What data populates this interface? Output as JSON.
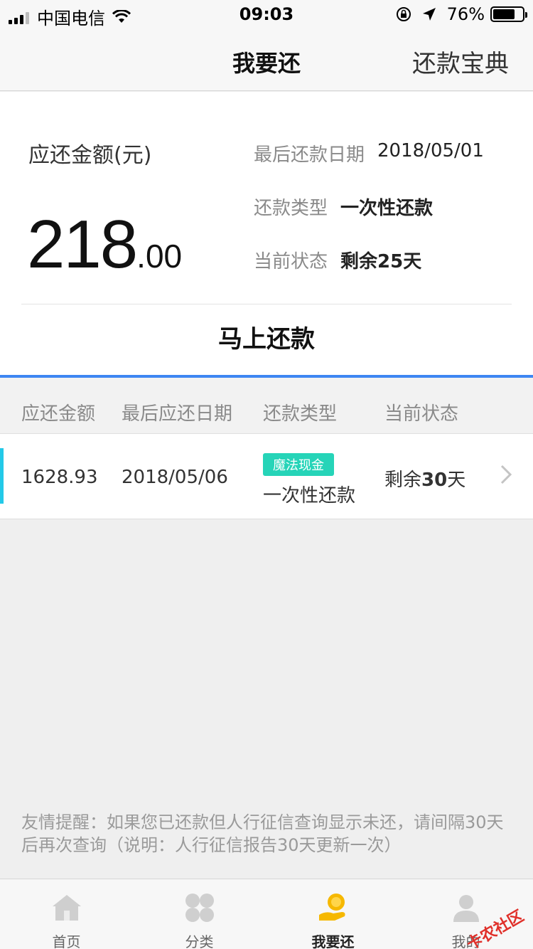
{
  "status_bar": {
    "carrier": "中国电信",
    "time": "09:03",
    "battery": "76%",
    "battery_level": 0.76
  },
  "nav": {
    "title": "我要还",
    "right_link": "还款宝典"
  },
  "summary": {
    "amount_label": "应还金额(元)",
    "amount_integer": "218",
    "amount_decimal": ".00",
    "due_date_label": "最后还款日期",
    "due_date": "2018/05/01",
    "type_label": "还款类型",
    "type": "一次性还款",
    "status_label": "当前状态",
    "status": "剩余25天",
    "pay_button": "马上还款"
  },
  "table": {
    "headers": [
      "应还金额",
      "最后应还日期",
      "还款类型",
      "当前状态"
    ],
    "rows": [
      {
        "amount": "1628.93",
        "date": "2018/05/06",
        "badge": "魔法现金",
        "type": "一次性还款",
        "status_prefix": "剩余",
        "status_number": "30",
        "status_suffix": "天"
      }
    ]
  },
  "reminder": "友情提醒：如果您已还款但人行征信查询显示未还，请间隔30天后再次查询（说明：人行征信报告30天更新一次）",
  "tabbar": {
    "items": [
      {
        "label": "首页",
        "icon": "home-icon"
      },
      {
        "label": "分类",
        "icon": "category-icon"
      },
      {
        "label": "我要还",
        "icon": "repay-coin-icon",
        "active": true
      },
      {
        "label": "我的",
        "icon": "profile-icon"
      }
    ]
  },
  "watermark": "卡农社区",
  "colors": {
    "accent_blue": "#3d86f2",
    "row_accent": "#23c9e8",
    "badge": "#26d4b8",
    "active_tab": "#f6b800"
  }
}
